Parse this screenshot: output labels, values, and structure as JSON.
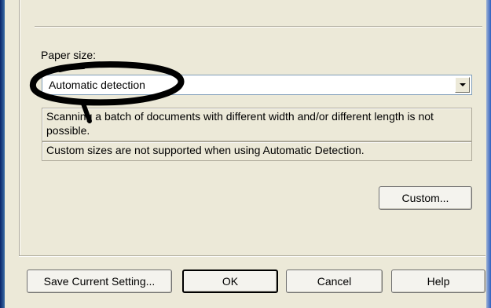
{
  "paper_size": {
    "label": "Paper size:",
    "selected": "Automatic detection",
    "info_lines": [
      "Scanning a batch of documents with different width and/or different length is not possible.",
      "Custom sizes are not supported when using Automatic Detection."
    ],
    "custom_button": "Custom..."
  },
  "footer": {
    "save_button": "Save Current Setting...",
    "ok_button": "OK",
    "cancel_button": "Cancel",
    "help_button": "Help"
  },
  "annotation": {
    "shape": "ellipse",
    "color": "#000000",
    "target": "paper-size-combo"
  }
}
